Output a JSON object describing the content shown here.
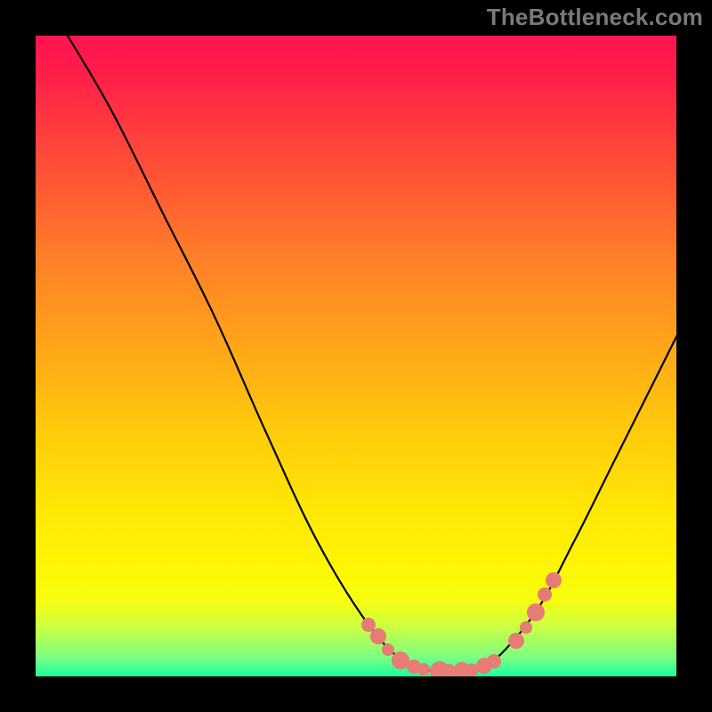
{
  "watermark": "TheBottleneck.com",
  "chart_data": {
    "type": "line",
    "title": "",
    "xlabel": "",
    "ylabel": "",
    "x_range": [
      0,
      100
    ],
    "y_range": [
      0,
      100
    ],
    "curve_points": [
      {
        "x": 5,
        "y": 100
      },
      {
        "x": 12,
        "y": 88
      },
      {
        "x": 20,
        "y": 72
      },
      {
        "x": 28,
        "y": 56
      },
      {
        "x": 36,
        "y": 38
      },
      {
        "x": 44,
        "y": 21
      },
      {
        "x": 52,
        "y": 8
      },
      {
        "x": 58,
        "y": 2
      },
      {
        "x": 63,
        "y": 0.8
      },
      {
        "x": 67,
        "y": 0.8
      },
      {
        "x": 71,
        "y": 2
      },
      {
        "x": 78,
        "y": 10
      },
      {
        "x": 84,
        "y": 21
      },
      {
        "x": 90,
        "y": 33
      },
      {
        "x": 96,
        "y": 45
      },
      {
        "x": 100,
        "y": 53
      }
    ],
    "highlight_points": [
      {
        "x": 52,
        "y": 8
      },
      {
        "x": 53.5,
        "y": 6.2
      },
      {
        "x": 55,
        "y": 4.2
      },
      {
        "x": 57,
        "y": 2.5
      },
      {
        "x": 59,
        "y": 1.5
      },
      {
        "x": 60.5,
        "y": 1.1
      },
      {
        "x": 63,
        "y": 0.9
      },
      {
        "x": 64.5,
        "y": 0.85
      },
      {
        "x": 66.5,
        "y": 0.85
      },
      {
        "x": 68,
        "y": 1.0
      },
      {
        "x": 70,
        "y": 1.6
      },
      {
        "x": 71.5,
        "y": 2.3
      },
      {
        "x": 75,
        "y": 5.5
      },
      {
        "x": 76.5,
        "y": 7.6
      },
      {
        "x": 78,
        "y": 10
      },
      {
        "x": 79.5,
        "y": 12.8
      },
      {
        "x": 80.8,
        "y": 15
      }
    ],
    "highlight_color": "#e77b76",
    "curve_color": "#000000",
    "gradient_colors_top_to_bottom": [
      "#ff1450",
      "#ff5a33",
      "#ffaa17",
      "#ffe706",
      "#f7fd0f",
      "#19ff9f"
    ]
  }
}
